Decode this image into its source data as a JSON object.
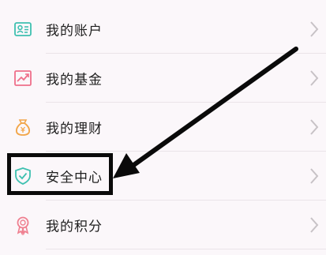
{
  "menu": {
    "items": [
      {
        "label": "我的账户",
        "icon": "id-card-icon",
        "color": "#3ec0b0"
      },
      {
        "label": "我的基金",
        "icon": "trend-chart-icon",
        "color": "#ef6f8a"
      },
      {
        "label": "我的理财",
        "icon": "money-bag-icon",
        "color": "#f2a64a"
      },
      {
        "label": "安全中心",
        "icon": "shield-check-icon",
        "color": "#3ec0b0"
      },
      {
        "label": "我的积分",
        "icon": "award-medal-icon",
        "color": "#ef7f8f"
      }
    ]
  },
  "annotation": {
    "highlighted_item": "安全中心",
    "arrow_color": "#0a0a0a"
  },
  "colors": {
    "background": "#fbf7fa",
    "divider": "#eae4e8",
    "chevron": "#c7c2c6",
    "text": "#1f1f1f"
  }
}
